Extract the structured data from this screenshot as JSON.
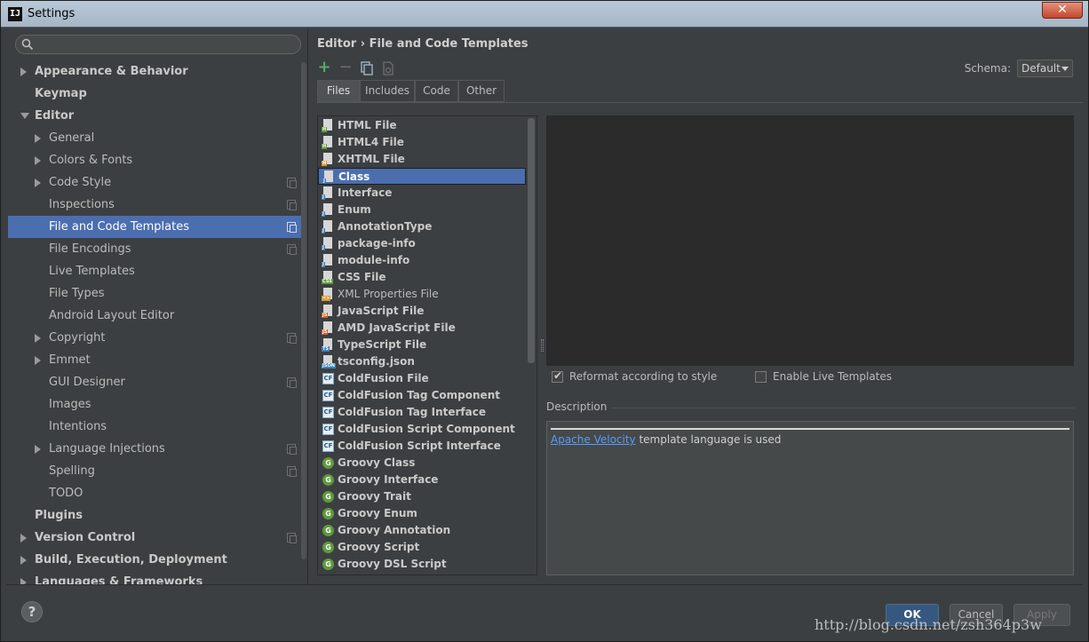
{
  "window": {
    "title": "Settings",
    "app_icon": "IJ"
  },
  "colors": {
    "selection": "#4b6eaf",
    "background": "#3c3f41",
    "editor": "#2b2b2b",
    "link": "#589df6",
    "ok_button": "#365880"
  },
  "sidebar": {
    "search_placeholder": "",
    "items": [
      {
        "label": "Appearance & Behavior",
        "bold": true,
        "arrow": "right",
        "indent": 0
      },
      {
        "label": "Keymap",
        "bold": true,
        "arrow": "",
        "indent": 0
      },
      {
        "label": "Editor",
        "bold": true,
        "arrow": "down",
        "indent": 0
      },
      {
        "label": "General",
        "bold": false,
        "arrow": "right",
        "indent": 1
      },
      {
        "label": "Colors & Fonts",
        "bold": false,
        "arrow": "right",
        "indent": 1
      },
      {
        "label": "Code Style",
        "bold": false,
        "arrow": "right",
        "indent": 1,
        "project_icon": true
      },
      {
        "label": "Inspections",
        "bold": false,
        "arrow": "",
        "indent": 1,
        "project_icon": true
      },
      {
        "label": "File and Code Templates",
        "bold": false,
        "arrow": "",
        "indent": 1,
        "project_icon": true,
        "selected": true
      },
      {
        "label": "File Encodings",
        "bold": false,
        "arrow": "",
        "indent": 1,
        "project_icon": true
      },
      {
        "label": "Live Templates",
        "bold": false,
        "arrow": "",
        "indent": 1
      },
      {
        "label": "File Types",
        "bold": false,
        "arrow": "",
        "indent": 1
      },
      {
        "label": "Android Layout Editor",
        "bold": false,
        "arrow": "",
        "indent": 1
      },
      {
        "label": "Copyright",
        "bold": false,
        "arrow": "right",
        "indent": 1,
        "project_icon": true
      },
      {
        "label": "Emmet",
        "bold": false,
        "arrow": "right",
        "indent": 1
      },
      {
        "label": "GUI Designer",
        "bold": false,
        "arrow": "",
        "indent": 1,
        "project_icon": true
      },
      {
        "label": "Images",
        "bold": false,
        "arrow": "",
        "indent": 1
      },
      {
        "label": "Intentions",
        "bold": false,
        "arrow": "",
        "indent": 1
      },
      {
        "label": "Language Injections",
        "bold": false,
        "arrow": "right",
        "indent": 1,
        "project_icon": true
      },
      {
        "label": "Spelling",
        "bold": false,
        "arrow": "",
        "indent": 1,
        "project_icon": true
      },
      {
        "label": "TODO",
        "bold": false,
        "arrow": "",
        "indent": 1
      },
      {
        "label": "Plugins",
        "bold": true,
        "arrow": "",
        "indent": 0
      },
      {
        "label": "Version Control",
        "bold": true,
        "arrow": "right",
        "indent": 0,
        "project_icon": true
      },
      {
        "label": "Build, Execution, Deployment",
        "bold": true,
        "arrow": "right",
        "indent": 0
      },
      {
        "label": "Languages & Frameworks",
        "bold": true,
        "arrow": "right",
        "indent": 0
      }
    ]
  },
  "main": {
    "breadcrumb": "Editor › File and Code Templates",
    "schema_label": "Schema:",
    "schema_value": "Default",
    "tabs": [
      {
        "label": "Files",
        "active": true
      },
      {
        "label": "Includes",
        "active": false
      },
      {
        "label": "Code",
        "active": false
      },
      {
        "label": "Other",
        "active": false
      }
    ],
    "files": [
      {
        "name": "HTML File",
        "icon": "html-file-icon",
        "tag": "H",
        "tag_color": "#5f9a3c",
        "bold": true
      },
      {
        "name": "HTML4 File",
        "icon": "html-file-icon",
        "tag": "H",
        "tag_color": "#5f9a3c",
        "bold": true
      },
      {
        "name": "XHTML File",
        "icon": "xhtml-file-icon",
        "tag": "H",
        "tag_color": "#d79b32",
        "bold": true
      },
      {
        "name": "Class",
        "icon": "java-class-icon",
        "tag": "J",
        "tag_color": "#3d7fb8",
        "bold": true,
        "selected": true
      },
      {
        "name": "Interface",
        "icon": "java-interface-icon",
        "tag": "J",
        "tag_color": "#3d7fb8",
        "bold": true
      },
      {
        "name": "Enum",
        "icon": "java-enum-icon",
        "tag": "J",
        "tag_color": "#3d7fb8",
        "bold": true
      },
      {
        "name": "AnnotationType",
        "icon": "java-annotation-icon",
        "tag": "J",
        "tag_color": "#3d7fb8",
        "bold": true
      },
      {
        "name": "package-info",
        "icon": "java-file-icon",
        "tag": "J",
        "tag_color": "#3d7fb8",
        "bold": true
      },
      {
        "name": "module-info",
        "icon": "java-file-icon",
        "tag": "J",
        "tag_color": "#3d7fb8",
        "bold": true
      },
      {
        "name": "CSS File",
        "icon": "css-file-icon",
        "tag": "CSS",
        "tag_color": "#5f9a3c",
        "bold": true
      },
      {
        "name": "XML Properties File",
        "icon": "xml-file-icon",
        "tag": "<>",
        "tag_color": "#d79b32",
        "bold": false
      },
      {
        "name": "JavaScript File",
        "icon": "javascript-file-icon",
        "tag": "JS",
        "tag_color": "#d0602e",
        "bold": true
      },
      {
        "name": "AMD JavaScript File",
        "icon": "javascript-file-icon",
        "tag": "JS",
        "tag_color": "#d0602e",
        "bold": true
      },
      {
        "name": "TypeScript File",
        "icon": "typescript-file-icon",
        "tag": "TS",
        "tag_color": "#3d7fb8",
        "bold": true
      },
      {
        "name": "tsconfig.json",
        "icon": "json-file-icon",
        "tag": "JSON",
        "tag_color": "#3d7fb8",
        "bold": true
      },
      {
        "name": "ColdFusion File",
        "icon": "coldfusion-icon",
        "tag": "CF",
        "bold": true
      },
      {
        "name": "ColdFusion Tag Component",
        "icon": "coldfusion-icon",
        "tag": "CF",
        "bold": true
      },
      {
        "name": "ColdFusion Tag Interface",
        "icon": "coldfusion-icon",
        "tag": "CF",
        "bold": true
      },
      {
        "name": "ColdFusion Script Component",
        "icon": "coldfusion-icon",
        "tag": "CF",
        "bold": true
      },
      {
        "name": "ColdFusion Script Interface",
        "icon": "coldfusion-icon",
        "tag": "CF",
        "bold": true
      },
      {
        "name": "Groovy Class",
        "icon": "groovy-icon",
        "tag": "G",
        "bold": true
      },
      {
        "name": "Groovy Interface",
        "icon": "groovy-icon",
        "tag": "G",
        "bold": true
      },
      {
        "name": "Groovy Trait",
        "icon": "groovy-icon",
        "tag": "G",
        "bold": true
      },
      {
        "name": "Groovy Enum",
        "icon": "groovy-icon",
        "tag": "G",
        "bold": true
      },
      {
        "name": "Groovy Annotation",
        "icon": "groovy-icon",
        "tag": "G",
        "bold": true
      },
      {
        "name": "Groovy Script",
        "icon": "groovy-icon",
        "tag": "G",
        "bold": true
      },
      {
        "name": "Groovy DSL Script",
        "icon": "groovy-icon",
        "tag": "G",
        "bold": true
      }
    ],
    "reformat_label": "Reformat according to style",
    "reformat_checked": true,
    "live_templates_label": "Enable Live Templates",
    "live_templates_checked": false,
    "description_label": "Description",
    "description_link": "Apache Velocity",
    "description_text": " template language is used"
  },
  "buttons": {
    "help": "?",
    "ok": "OK",
    "cancel": "Cancel",
    "apply": "Apply"
  },
  "watermark": "http://blog.csdn.net/zsh364p3w"
}
